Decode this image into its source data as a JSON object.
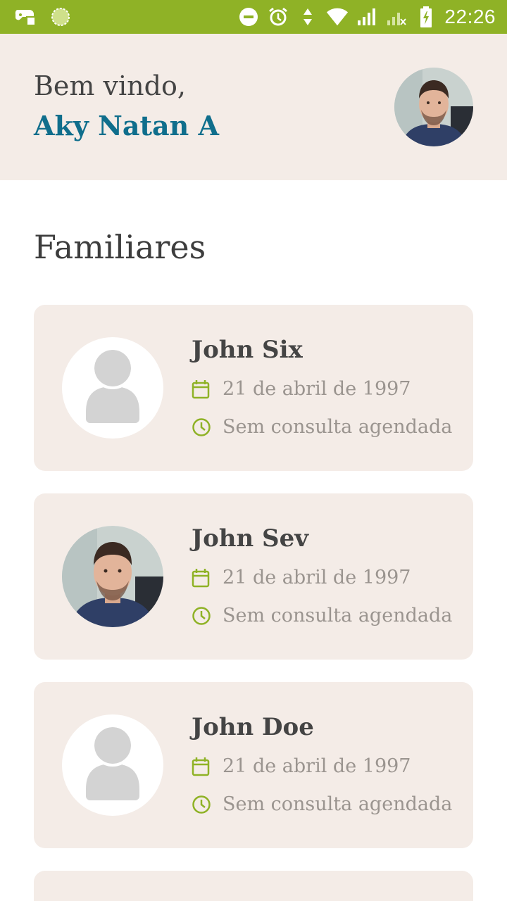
{
  "status_bar": {
    "time": "22:26",
    "color": "#8fb226",
    "icons_left": [
      "game-controller-icon",
      "loading-circle-icon"
    ],
    "icons_right": [
      "do-not-disturb-icon",
      "alarm-icon",
      "data-arrows-icon",
      "wifi-icon",
      "signal-icon",
      "signal-no-service-icon",
      "battery-charging-icon"
    ]
  },
  "header": {
    "greeting": "Bem vindo,",
    "user_name": "Aky Natan A",
    "accent_color": "#0f6e8c",
    "background": "#f4ece7"
  },
  "section": {
    "title": "Familiares"
  },
  "members": [
    {
      "name": "John Six",
      "birth_date": "21 de abril de 1997",
      "appointment": "Sem consulta agendada",
      "avatar": "placeholder"
    },
    {
      "name": "John Sev",
      "birth_date": "21 de abril de 1997",
      "appointment": "Sem consulta agendada",
      "avatar": "photo"
    },
    {
      "name": "John Doe",
      "birth_date": "21 de abril de 1997",
      "appointment": "Sem consulta agendada",
      "avatar": "placeholder"
    }
  ],
  "icon_color": "#8fb226"
}
